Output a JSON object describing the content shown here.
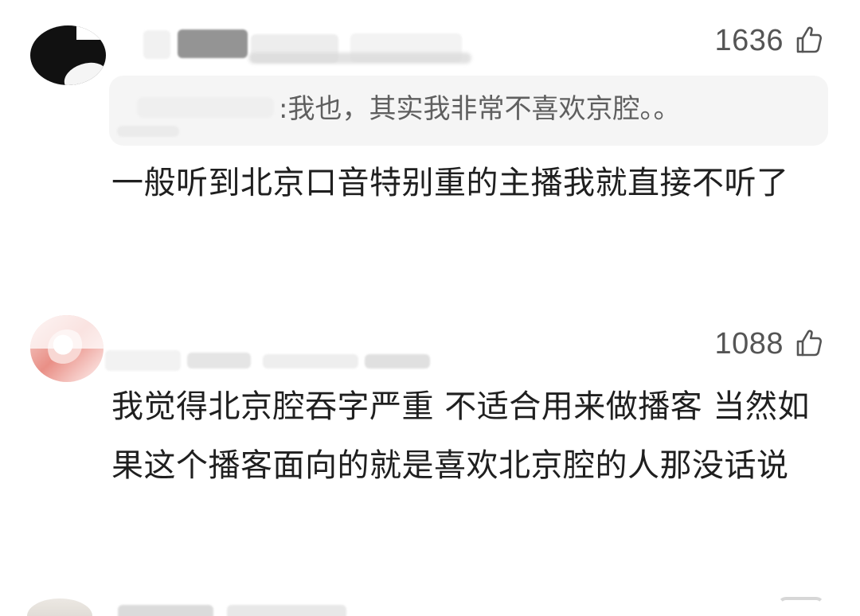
{
  "comments": [
    {
      "likes": "1636",
      "reply": ":我也，其实我非常不喜欢京腔。。",
      "text": "一般听到北京口音特别重的主播我就直接不听了"
    },
    {
      "likes": "1088",
      "text": "我觉得北京腔吞字严重 不适合用来做播客 当然如果这个播客面向的就是喜欢北京腔的人那没话说"
    }
  ],
  "icons": {
    "like": "thumbs-up-icon"
  }
}
